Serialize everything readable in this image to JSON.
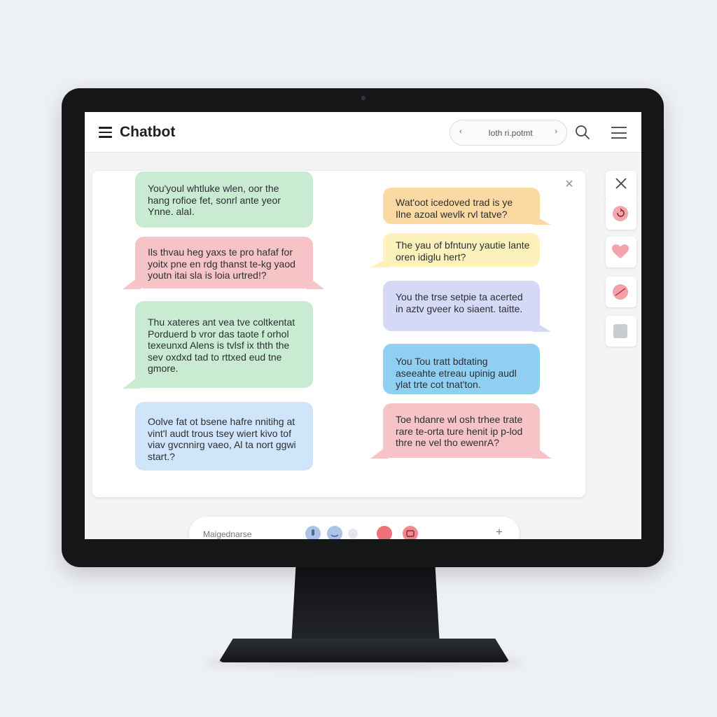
{
  "header": {
    "title": "Chatbot",
    "search_text": "Ioth ri.potmt",
    "search_left_chevron": "‹",
    "search_right_chevron": "›"
  },
  "panel": {
    "close_glyph": "×"
  },
  "bubbles_left": [
    {
      "text": "You'youl whtluke wlen, oor the hang rofioe fet, sonrl ante yeor Ynne. alaI.",
      "color": "#c8ebd2"
    },
    {
      "text": "Ils thvau heg yaxs te pro hafaf for yoitx pne en rdg thanst te-kg yaod youtn itai sla is loia urtred!?",
      "color": "#f6c3c6"
    },
    {
      "text": "Thu xateres ant vea tve coltkentat Porduerd b vror das taote f orhol texeunxd Alens is tvlsf ix thth the sev oxdxd tad to rttxed eud tne gmore.",
      "color": "#c8ebd2"
    },
    {
      "text": "Oolve fat ot bsene hafre nnitihg at vint'l audt trous tsey wiert kivo tof viav gvcnnirg vaeo, Al ta nort ggwi start.?",
      "color": "#cfe5fa"
    }
  ],
  "bubbles_right": [
    {
      "text": "Wat'oot icedoved trad is ye Ilne azoal wevlk rvl tatve?",
      "color": "#fbd9a2"
    },
    {
      "text": "The yau of bfntuny yautie lante oren idiglu hert?",
      "color": "#fdf2bc"
    },
    {
      "text": "You the trse setpie ta acerted in aztv gveer ko siaent. taitte.",
      "color": "#d5d8f6"
    },
    {
      "text": "You Tou tratt bdtating aseeahte etreau upinig audl ylat trte cot tnat'ton.",
      "color": "#8fd0f2"
    },
    {
      "text": "Toe hdanre wl osh trhee trate rare te-orta ture henit ip p-lod thre ne vel tho ewenrA?",
      "color": "#f6c3c6"
    }
  ],
  "input": {
    "placeholder": "Maigednarse",
    "plus_label": "+"
  },
  "colors": {
    "accent_red": "#ee7079",
    "accent_blue": "#a9c4e6"
  },
  "icons": [
    "menu-icon",
    "search-icon",
    "hamburger-icon",
    "close-icon",
    "refresh-icon",
    "heart-icon",
    "no-icon",
    "image-icon",
    "plus-icon"
  ]
}
